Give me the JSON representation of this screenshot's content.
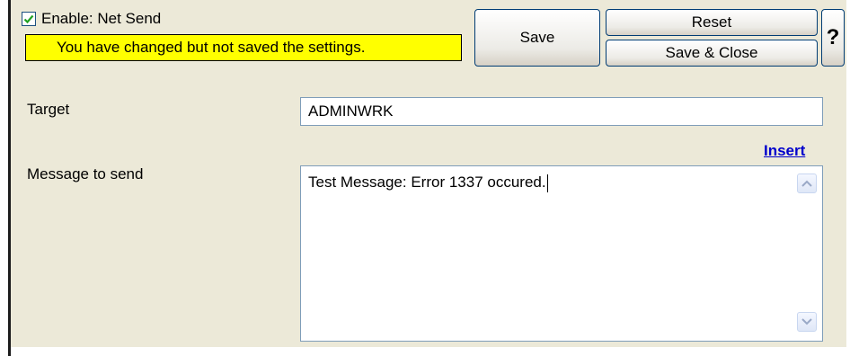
{
  "header": {
    "enable_label": "Enable: Net Send",
    "enable_checked": true,
    "warning": "You have changed but not saved the settings.",
    "save_label": "Save",
    "reset_label": "Reset",
    "save_close_label": "Save & Close",
    "help_label": "?"
  },
  "form": {
    "target_label": "Target",
    "target_value": "ADMINWRK",
    "insert_label": "Insert",
    "message_label": "Message to send",
    "message_value": "Test Message: Error 1337 occured."
  },
  "icons": {
    "checkbox": "checkmark-icon",
    "scroll_up": "scroll-up-arrow-icon",
    "scroll_down": "scroll-down-arrow-icon"
  },
  "colors": {
    "panel_bg": "#ece9d8",
    "warning_bg": "#ffff00",
    "link": "#0000cc",
    "checkmark": "#21a121"
  }
}
